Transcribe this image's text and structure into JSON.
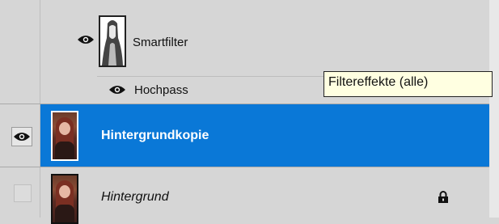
{
  "layers": {
    "smart_filter": {
      "label": "Smartfilter",
      "eye_icon": "eye-icon",
      "mask_icon": "filter-mask-thumbnail"
    },
    "hochpass": {
      "label": "Hochpass",
      "eye_icon": "eye-icon"
    },
    "background_copy": {
      "label": "Hintergrundkopie",
      "selected": true,
      "eye_icon": "eye-icon"
    },
    "background": {
      "label": "Hintergrund",
      "locked": true,
      "lock_icon": "lock-icon"
    }
  },
  "tooltip": {
    "text": "Filtereffekte (alle)"
  },
  "colors": {
    "selection": "#0a78d7",
    "panel": "#d6d6d6",
    "tooltip_bg": "#ffffe1"
  }
}
